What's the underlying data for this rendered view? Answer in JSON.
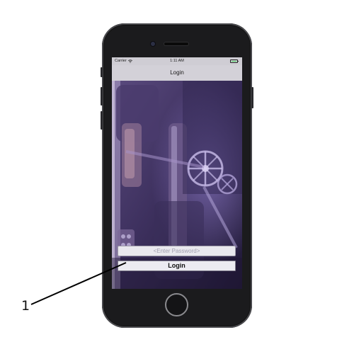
{
  "status_bar": {
    "carrier": "Carrier",
    "time": "1:11 AM",
    "wifi_icon": "wifi-icon",
    "battery_icon": "battery-icon"
  },
  "nav": {
    "title": "Login"
  },
  "login_form": {
    "password_placeholder": "<Enter Password>",
    "login_label": "Login"
  },
  "callout": {
    "number": "1"
  },
  "colors": {
    "screen_tint": "#4b3a78",
    "field_bg": "#e9e8ee",
    "status_bg": "#cfcdd4"
  }
}
